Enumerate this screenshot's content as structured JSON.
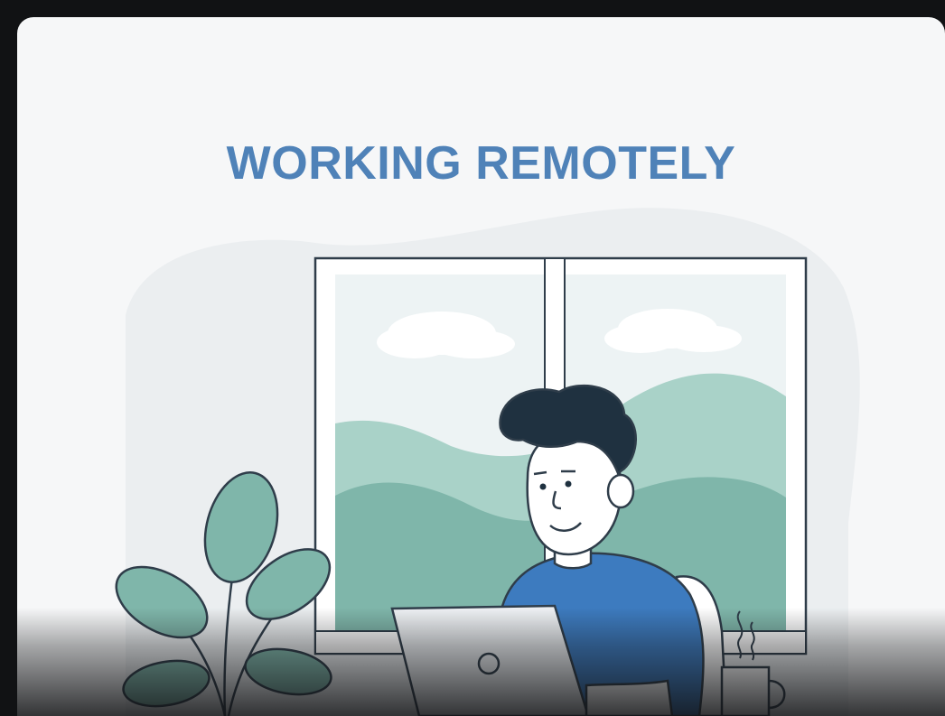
{
  "card": {
    "title": "WORKING REMOTELY"
  },
  "colors": {
    "title": "#4f82b8",
    "background": "#f6f7f8",
    "blob": "#ebeef0",
    "outline": "#2f3d4a",
    "hills_light": "#a9d2c8",
    "hills_dark": "#7fb6aa",
    "plant": "#7fb6aa",
    "shirt": "#3d7bbf",
    "hair": "#1f3140",
    "skin": "#ffffff"
  },
  "icons": [
    "cloud-icon",
    "plant-icon",
    "laptop-icon",
    "coffee-mug-icon",
    "steam-icon"
  ]
}
